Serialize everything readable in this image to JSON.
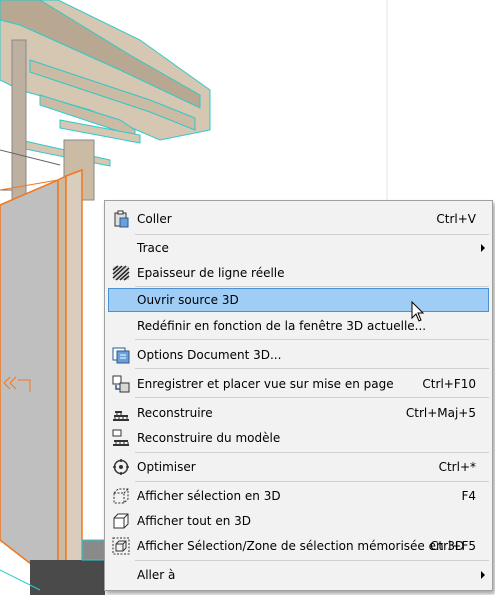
{
  "context_menu": {
    "items": [
      {
        "label": "Coller",
        "shortcut": "Ctrl+V",
        "icon": "clipboard-icon"
      },
      {
        "label": "Trace",
        "submenu": true
      },
      {
        "label": "Epaisseur de ligne réelle",
        "icon": "line-weight-icon"
      },
      {
        "label": "Ouvrir source 3D",
        "highlighted": true
      },
      {
        "label": "Redéfinir en fonction de la fenêtre 3D actuelle..."
      },
      {
        "label": "Options Document 3D...",
        "icon": "document-options-icon"
      },
      {
        "label": "Enregistrer et placer vue sur mise en page",
        "shortcut": "Ctrl+F10",
        "icon": "save-place-view-icon"
      },
      {
        "label": "Reconstruire",
        "shortcut": "Ctrl+Maj+5",
        "icon": "rebuild-icon"
      },
      {
        "label": "Reconstruire du modèle",
        "icon": "rebuild-model-icon"
      },
      {
        "label": "Optimiser",
        "shortcut": "Ctrl+*",
        "icon": "optimize-icon"
      },
      {
        "label": "Afficher sélection en 3D",
        "shortcut": "F4",
        "icon": "show-selection-3d-icon"
      },
      {
        "label": "Afficher tout en 3D",
        "icon": "show-all-3d-icon"
      },
      {
        "label": "Afficher Sélection/Zone de sélection mémorisée en 3D",
        "shortcut": "Ctrl+F5",
        "icon": "show-marquee-3d-icon"
      },
      {
        "label": "Aller à",
        "submenu": true
      }
    ]
  },
  "colors": {
    "menu_bg": "#f2f2f2",
    "highlight_bg": "#9fcdf6",
    "highlight_border": "#4a90d2",
    "beam_fill": "#d6c7b3",
    "cyan_edges": "#2ec9c9",
    "orange_selection": "#f07820",
    "panel_gray": "#bfbfbf"
  }
}
